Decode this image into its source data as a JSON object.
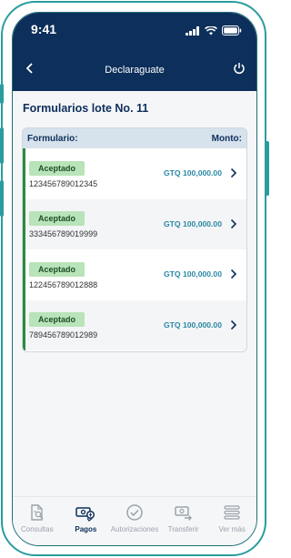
{
  "status_bar": {
    "time": "9:41"
  },
  "header": {
    "title": "Declaraguate"
  },
  "page": {
    "title": "Formularios lote No. 11"
  },
  "table": {
    "col_form": "Formulario:",
    "col_amount": "Monto:",
    "rows": [
      {
        "status": "Aceptado",
        "id": "123456789012345",
        "amount": "GTQ 100,000.00"
      },
      {
        "status": "Aceptado",
        "id": "333456789019999",
        "amount": "GTQ 100,000.00"
      },
      {
        "status": "Aceptado",
        "id": "122456789012888",
        "amount": "GTQ 100,000.00"
      },
      {
        "status": "Aceptado",
        "id": "789456789012989",
        "amount": "GTQ 100,000.00"
      }
    ]
  },
  "nav": {
    "items": [
      {
        "label": "Consultas",
        "icon": "document-search-icon"
      },
      {
        "label": "Pagos",
        "icon": "payment-icon"
      },
      {
        "label": "Autorizaciones",
        "icon": "check-circle-icon"
      },
      {
        "label": "Transferir",
        "icon": "transfer-icon"
      },
      {
        "label": "Ver más",
        "icon": "menu-icon"
      }
    ],
    "active": "Pagos"
  },
  "colors": {
    "brand": "#0d2f5b",
    "accent": "#2a9d9f",
    "accepted_badge": "#b9e3b8",
    "amount": "#2a88a5"
  }
}
